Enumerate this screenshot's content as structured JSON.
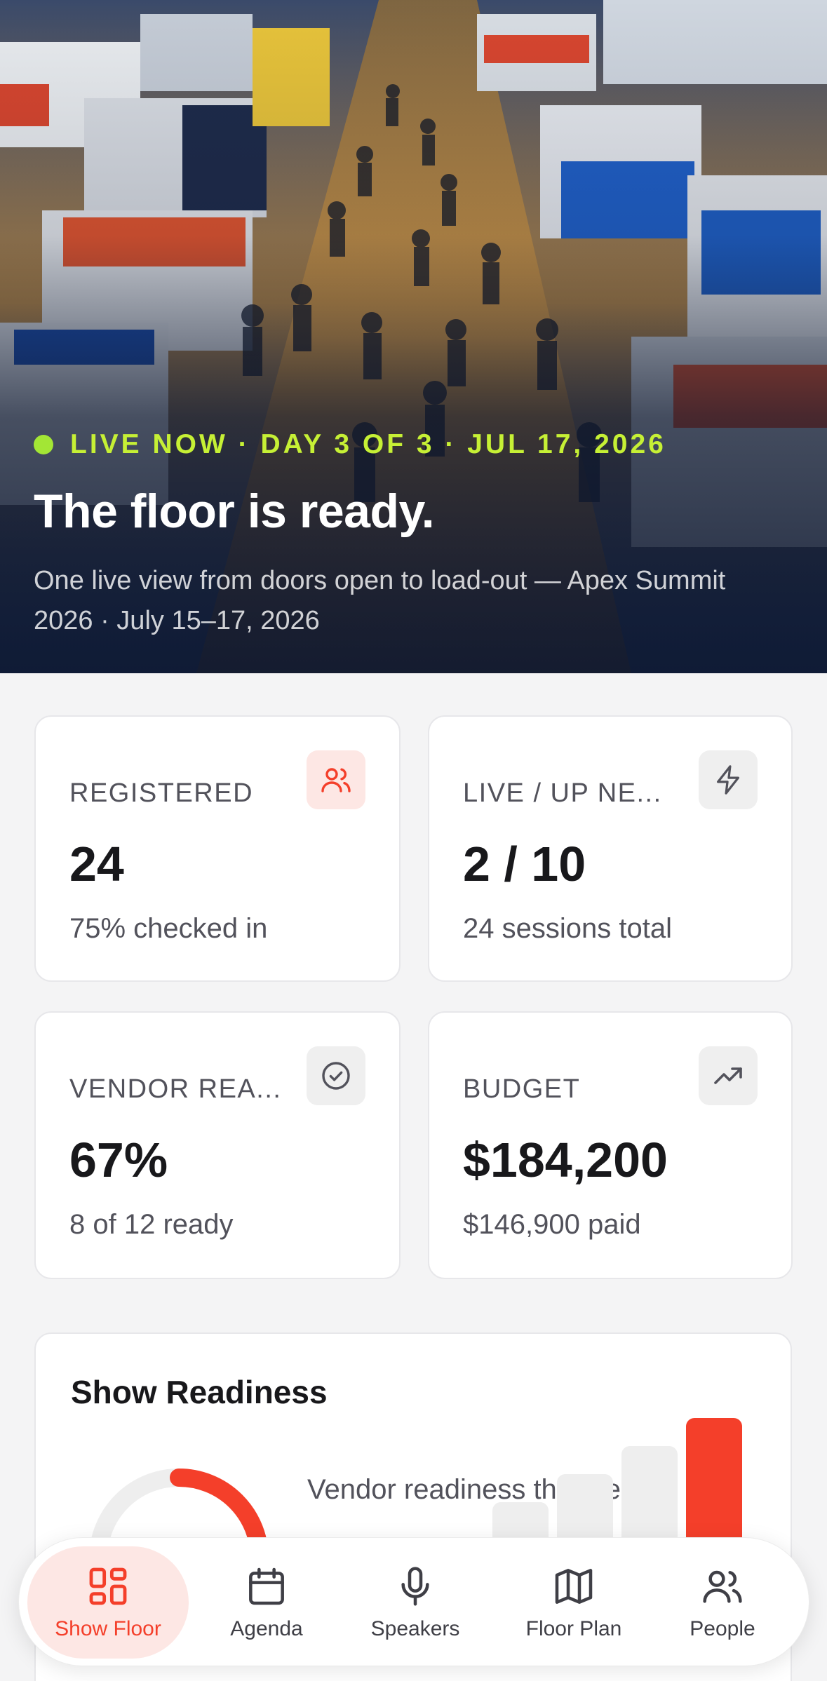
{
  "hero": {
    "live_text": "LIVE NOW · DAY 3 OF 3 · JUL 17, 2026",
    "title": "The floor is ready.",
    "subtitle": "One live view from doors open to load-out — Apex Summit 2026 · July 15–17, 2026"
  },
  "stats": [
    {
      "label": "REGISTERED",
      "value": "24",
      "sub": "75% checked in",
      "icon": "users-icon"
    },
    {
      "label": "LIVE / UP NE...",
      "value": "2 / 10",
      "sub": "24 sessions total",
      "icon": "lightning-icon"
    },
    {
      "label": "VENDOR REA...",
      "value": "67%",
      "sub": "8 of 12 ready",
      "icon": "check-circle-icon"
    },
    {
      "label": "BUDGET",
      "value": "$184,200",
      "sub": "$146,900 paid",
      "icon": "trending-up-icon"
    }
  ],
  "readiness": {
    "title": "Show Readiness",
    "caption": "Vendor readiness this week",
    "donut_percent": 67,
    "week_bars": [
      0.15,
      0.3,
      0.45,
      0.55,
      0.65,
      0.75
    ]
  },
  "nav": [
    {
      "label": "Show Floor",
      "icon": "grid-icon",
      "active": true
    },
    {
      "label": "Agenda",
      "icon": "calendar-icon",
      "active": false
    },
    {
      "label": "Speakers",
      "icon": "microphone-icon",
      "active": false
    },
    {
      "label": "Floor Plan",
      "icon": "map-icon",
      "active": false
    },
    {
      "label": "People",
      "icon": "people-icon",
      "active": false
    }
  ],
  "colors": {
    "accent": "#f43f2a",
    "live": "#a3e635",
    "hero_overlay": "#0e1830"
  }
}
